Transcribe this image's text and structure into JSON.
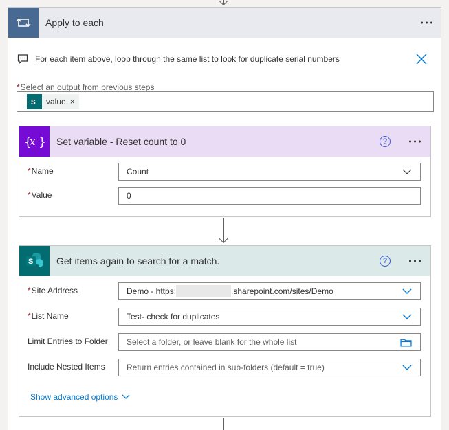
{
  "apply": {
    "title": "Apply to each",
    "comment": "For each item above, loop through the same list to look for duplicate serial numbers",
    "select_label": "Select an output from previous steps",
    "token": "value",
    "token_remove": "×"
  },
  "set_variable": {
    "title": "Set variable - Reset count to 0",
    "help": "?",
    "name_label": "Name",
    "name_value": "Count",
    "value_label": "Value",
    "value_value": "0"
  },
  "get_items": {
    "title": "Get items again to search for a match.",
    "help": "?",
    "site_label": "Site Address",
    "site_prefix": "Demo - https:",
    "site_suffix": ".sharepoint.com/sites/Demo",
    "list_label": "List Name",
    "list_value": "Test- check for duplicates",
    "folder_label": "Limit Entries to Folder",
    "folder_placeholder": "Select a folder, or leave blank for the whole list",
    "nested_label": "Include Nested Items",
    "nested_value": "Return entries contained in sub-folders (default = true)",
    "advanced": "Show advanced options"
  },
  "required_marker": "*",
  "colors": {
    "apply_header_bg": "#e8eaef",
    "apply_icon_bg": "#486991",
    "variable_header_bg": "#ebdcf5",
    "variable_icon_bg": "#770bd6",
    "sharepoint_header_bg": "#dbe9e9",
    "sharepoint_icon_bg": "#036c70",
    "link": "#0078d4"
  }
}
